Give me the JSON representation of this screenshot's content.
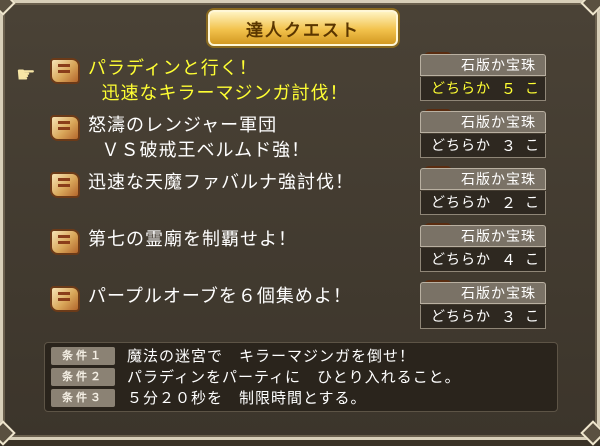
{
  "window": {
    "title": "達人クエスト"
  },
  "quests": [
    {
      "title": "パラディンと行く！\n  迅速なキラーマジンガ討伐！",
      "reward_type": "石版か宝珠",
      "reward_prefix": "どちらか",
      "reward_count": "５",
      "reward_unit": "こ",
      "chest": "open",
      "selected": true
    },
    {
      "title": "怒濤のレンジャー軍団\n  ＶＳ破戒王ベルムド強！",
      "reward_type": "石版か宝珠",
      "reward_prefix": "どちらか",
      "reward_count": "３",
      "reward_unit": "こ",
      "chest": "red",
      "selected": false
    },
    {
      "title": "迅速な天魔ファバルナ強討伐！",
      "reward_type": "石版か宝珠",
      "reward_prefix": "どちらか",
      "reward_count": "２",
      "reward_unit": "こ",
      "chest": "red",
      "selected": false
    },
    {
      "title": "第七の霊廟を制覇せよ！",
      "reward_type": "石版か宝珠",
      "reward_prefix": "どちらか",
      "reward_count": "４",
      "reward_unit": "こ",
      "chest": "dark",
      "selected": false
    },
    {
      "title": "パープルオーブを６個集めよ！",
      "reward_type": "石版か宝珠",
      "reward_prefix": "どちらか",
      "reward_count": "３",
      "reward_unit": "こ",
      "chest": "red",
      "selected": false
    }
  ],
  "conditions": [
    {
      "label": "条件１",
      "text": "魔法の迷宮で　キラーマジンガを倒せ！"
    },
    {
      "label": "条件２",
      "text": "パラディンをパーティに　ひとり入れること。"
    },
    {
      "label": "条件３",
      "text": "５分２０秒を　制限時間とする。"
    }
  ],
  "colors": {
    "selected_text": "#ffff33",
    "title_plate": "#f2c24c",
    "panel": "#4a4236"
  }
}
